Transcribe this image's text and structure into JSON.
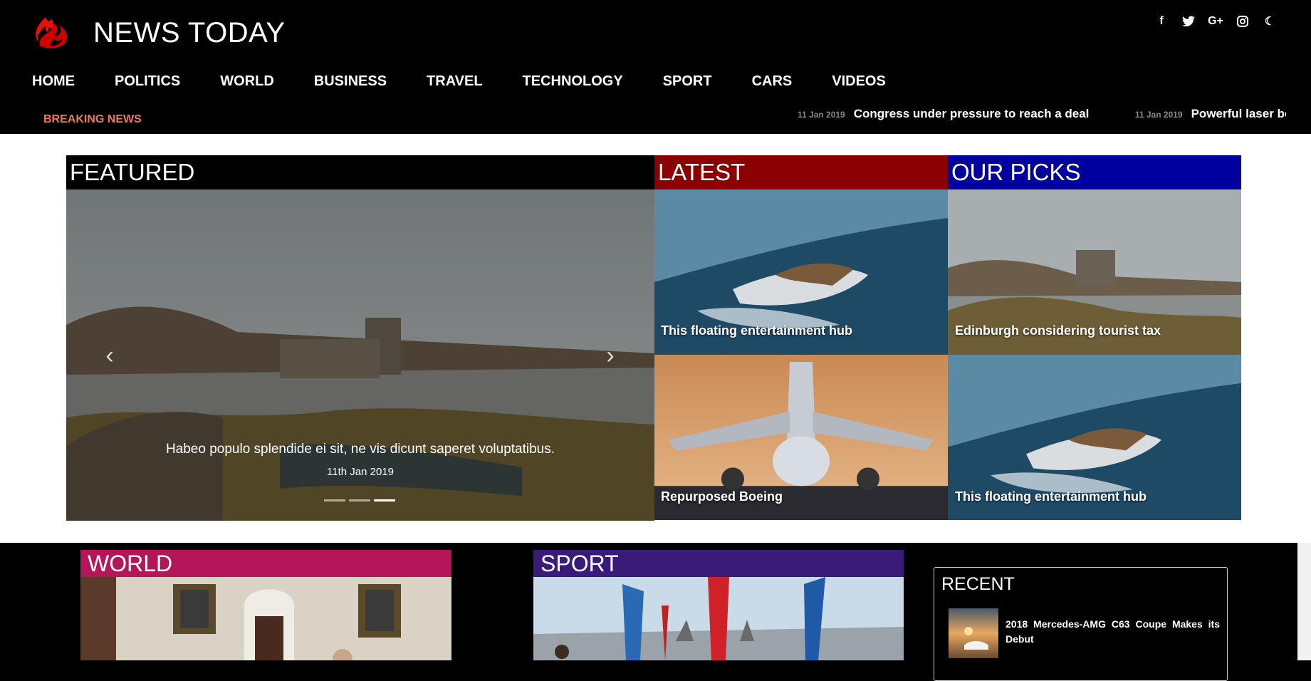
{
  "site": {
    "title": "NEWS TODAY"
  },
  "social": [
    "f",
    "t",
    "G+",
    "ig",
    "☾"
  ],
  "nav": [
    "HOME",
    "POLITICS",
    "WORLD",
    "BUSINESS",
    "TRAVEL",
    "TECHNOLOGY",
    "SPORT",
    "CARS",
    "VIDEOS"
  ],
  "breaking": {
    "label": "BREAKING NEWS",
    "items": [
      {
        "date": "11 Jan 2019",
        "title": "Congress under pressure to reach a deal"
      },
      {
        "date": "11 Jan 2019",
        "title": "Powerful laser beam"
      }
    ]
  },
  "sections": {
    "featured": "FEATURED",
    "latest": "LATEST",
    "picks": "OUR PICKS",
    "world": "WORLD",
    "sport": "SPORT",
    "recent": "RECENT"
  },
  "slider": {
    "caption": "Habeo populo splendide ei sit, ne vis dicunt saperet voluptatibus.",
    "date": "11th Jan 2019",
    "slide_count": 3,
    "active_slide": 3
  },
  "latest": [
    {
      "title": "This floating entertainment hub"
    },
    {
      "title": "Repurposed Boeing"
    }
  ],
  "picks": [
    {
      "title": "Edinburgh considering tourist tax"
    },
    {
      "title": "This floating entertainment hub"
    }
  ],
  "recent": [
    {
      "title": "2018 Mercedes-AMG C63 Coupe Makes its Debut"
    }
  ],
  "colors": {
    "latest": "#8b0000",
    "picks": "#00009f",
    "world": "#b5165a",
    "sport": "#3b1b79",
    "breaking": "#ec7a55"
  }
}
